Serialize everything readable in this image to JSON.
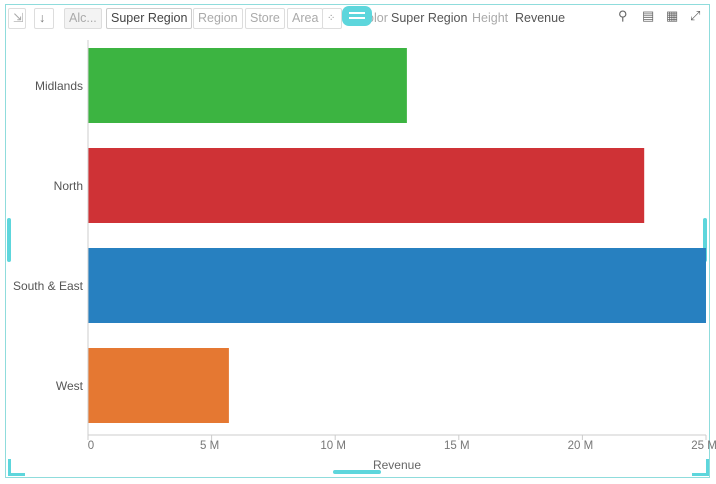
{
  "toolbar": {
    "fields": [
      "Alc...",
      "Super Region",
      "Region",
      "Store",
      "Area"
    ],
    "color_label": "Color",
    "color_value": "Super Region",
    "height_label": "Height",
    "height_value": "Revenue"
  },
  "chart_data": {
    "type": "bar",
    "orientation": "horizontal",
    "categories": [
      "Midlands",
      "North",
      "South & East",
      "West"
    ],
    "values": [
      12.9,
      22.5,
      25.1,
      5.7
    ],
    "colors": [
      "#3cb441",
      "#cf3236",
      "#2780c0",
      "#e57832"
    ],
    "xlabel": "Revenue",
    "ylabel": "",
    "xlim": [
      0,
      25
    ],
    "xticks": [
      0,
      5,
      10,
      15,
      20,
      25
    ],
    "xtick_labels": [
      "0",
      "5 M",
      "10 M",
      "15 M",
      "20 M",
      "25 M"
    ],
    "unit": "M",
    "grid": false
  }
}
